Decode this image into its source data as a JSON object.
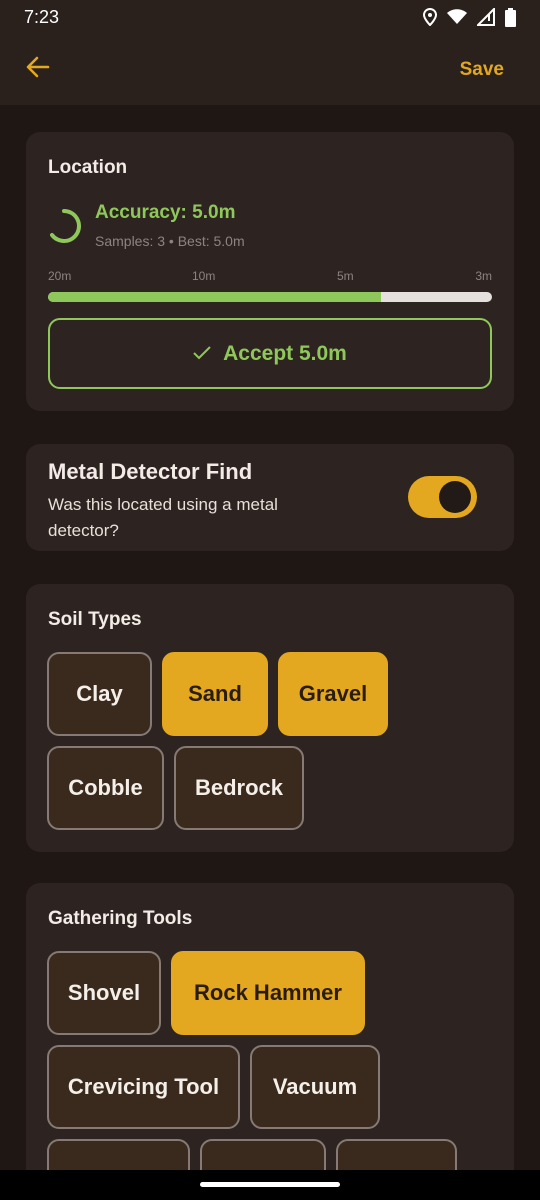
{
  "status_bar": {
    "time": "7:23",
    "icons": [
      "location-icon",
      "wifi-icon",
      "signal-icon",
      "battery-icon"
    ]
  },
  "app_bar": {
    "back_icon": "arrow-left-icon",
    "save_label": "Save",
    "accent_color": "#e3a81f"
  },
  "location": {
    "title": "Location",
    "accuracy_text": "Accuracy: 5.0m",
    "samples_text": "Samples: 3 • Best: 5.0m",
    "scale_labels": [
      "20m",
      "10m",
      "5m",
      "3m"
    ],
    "progress_fraction": 0.75,
    "accept_label": "Accept 5.0m",
    "accept_icon": "check-icon",
    "status_color": "#8fc85a"
  },
  "metal_detector": {
    "title": "Metal Detector Find",
    "subtitle": "Was this located using a metal detector?",
    "enabled": true
  },
  "soil_types": {
    "title": "Soil Types",
    "chips": [
      {
        "label": "Clay",
        "selected": false
      },
      {
        "label": "Sand",
        "selected": true
      },
      {
        "label": "Gravel",
        "selected": true
      },
      {
        "label": "Cobble",
        "selected": false
      },
      {
        "label": "Bedrock",
        "selected": false
      }
    ]
  },
  "gathering_tools": {
    "title": "Gathering Tools",
    "chips": [
      {
        "label": "Shovel",
        "selected": false
      },
      {
        "label": "Rock Hammer",
        "selected": true
      },
      {
        "label": "Crevicing Tool",
        "selected": false
      },
      {
        "label": "Vacuum",
        "selected": false
      }
    ]
  }
}
